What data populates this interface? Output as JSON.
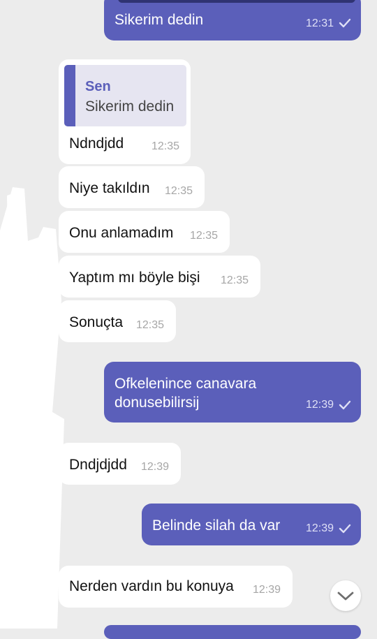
{
  "messages": [
    {
      "direction": "outgoing",
      "text": "Sikerim dedin",
      "time": "12:31",
      "status_icon": "check-icon"
    },
    {
      "direction": "incoming",
      "reply_to": {
        "author": "Sen",
        "text": "Sikerim dedin"
      },
      "text": "Ndndjdd",
      "time": "12:35"
    },
    {
      "direction": "incoming",
      "text": "Niye takıldın",
      "time": "12:35"
    },
    {
      "direction": "incoming",
      "text": "Onu anlamadım",
      "time": "12:35"
    },
    {
      "direction": "incoming",
      "text": "Yaptım mı böyle bişi",
      "time": "12:35"
    },
    {
      "direction": "incoming",
      "text": "Sonuçta",
      "time": "12:35"
    },
    {
      "direction": "outgoing",
      "text_lines": [
        "Ofkelenince canavara",
        "donusebilirsij"
      ],
      "time": "12:39",
      "status_icon": "check-icon"
    },
    {
      "direction": "incoming",
      "text": "Dndjdjdd",
      "time": "12:39"
    },
    {
      "direction": "outgoing",
      "text": "Belinde silah da var",
      "time": "12:39",
      "status_icon": "check-icon"
    },
    {
      "direction": "incoming",
      "text": "Nerden vardın bu konuya",
      "time": "12:39"
    }
  ],
  "scroll_button": {
    "icon": "chevron-down-icon"
  },
  "colors": {
    "background": "#ececec",
    "incoming_bubble": "#ffffff",
    "outgoing_bubble": "#5b5fba",
    "reply_quote_bg": "#e6e5f1",
    "reply_accent": "#5b5fba",
    "top_attachment_bar": "#2f3372"
  }
}
